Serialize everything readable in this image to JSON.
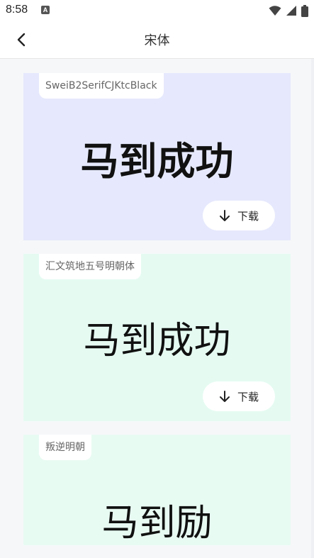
{
  "status_bar": {
    "time": "8:58",
    "notification_icon_letter": "A"
  },
  "app_bar": {
    "title": "宋体"
  },
  "preview_sample": "马到成功",
  "cards": [
    {
      "font_name": "SweiB2SerifCJKtcBlack",
      "bg_color": "#e6e9fd",
      "download_label": "下载"
    },
    {
      "font_name": "汇文筑地五号明朝体",
      "bg_color": "#e5fbf2",
      "download_label": "下载"
    },
    {
      "font_name": "叛逆明朝",
      "bg_color": "#e8fbf3",
      "preview_override": "马到励"
    }
  ],
  "colors": {
    "accent_text": "#111111",
    "tag_text": "#666666"
  }
}
